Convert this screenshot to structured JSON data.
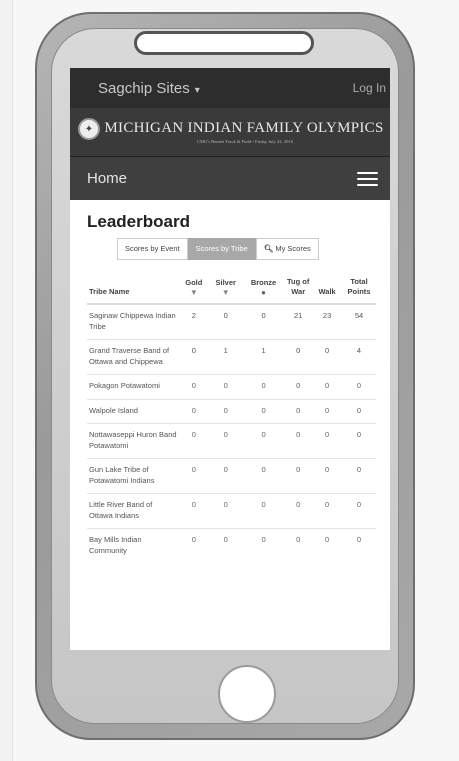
{
  "site": {
    "brand": "Sagchip Sites",
    "brand_caret": "▾",
    "login": "Log In"
  },
  "banner": {
    "title": "MICHIGAN INDIAN FAMILY OLYMPICS",
    "subtitle": "CMU's Bennet Track & Field • Friday July 22, 2016"
  },
  "nav": {
    "home": "Home"
  },
  "leaderboard": {
    "title": "Leaderboard",
    "tabs": [
      {
        "label": "Scores by Event",
        "active": false
      },
      {
        "label": "Scores by Tribe",
        "active": true
      },
      {
        "label": "My Scores",
        "active": false
      }
    ],
    "columns": [
      "Tribe Name",
      "Gold",
      "Silver",
      "Bronze",
      "Tug of War",
      "Walk",
      "Total Points"
    ],
    "rows": [
      {
        "tribe": "Saginaw Chippewa Indian Tribe",
        "gold": "2",
        "silver": "0",
        "bronze": "0",
        "tug": "21",
        "walk": "23",
        "total": "54",
        "dark": true
      },
      {
        "tribe": "Grand Traverse Band of Ottawa and Chippewa",
        "gold": "0",
        "silver": "1",
        "bronze": "1",
        "tug": "0",
        "walk": "0",
        "total": "4",
        "dark": true
      },
      {
        "tribe": "Pokagon Potawatomi",
        "gold": "0",
        "silver": "0",
        "bronze": "0",
        "tug": "0",
        "walk": "0",
        "total": "0",
        "dark": false
      },
      {
        "tribe": "Walpole Island",
        "gold": "0",
        "silver": "0",
        "bronze": "0",
        "tug": "0",
        "walk": "0",
        "total": "0",
        "dark": false
      },
      {
        "tribe": "Nottawaseppi Huron Band Potawatomi",
        "gold": "0",
        "silver": "0",
        "bronze": "0",
        "tug": "0",
        "walk": "0",
        "total": "0",
        "dark": false
      },
      {
        "tribe": "Gun Lake Tribe of Potawatomi Indians",
        "gold": "0",
        "silver": "0",
        "bronze": "0",
        "tug": "0",
        "walk": "0",
        "total": "0",
        "dark": false
      },
      {
        "tribe": "Little River Band of Ottawa Indians",
        "gold": "0",
        "silver": "0",
        "bronze": "0",
        "tug": "0",
        "walk": "0",
        "total": "0",
        "dark": false
      },
      {
        "tribe": "Bay Mills Indian Community",
        "gold": "0",
        "silver": "0",
        "bronze": "0",
        "tug": "0",
        "walk": "0",
        "total": "0",
        "dark": false
      }
    ]
  },
  "icons": {
    "search": "search-icon",
    "menu": "hamburger-menu-icon",
    "medal": "medal-icon",
    "logo": "seal-logo-icon"
  }
}
